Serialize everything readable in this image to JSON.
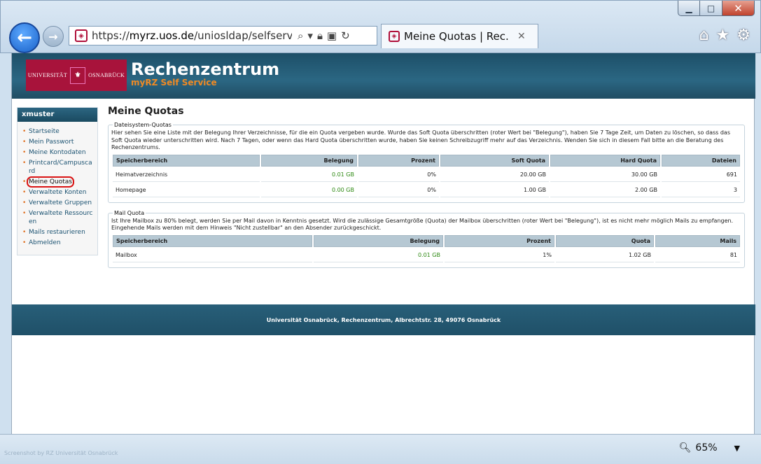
{
  "browser": {
    "url_prefix": "https://",
    "url_host": "myrz.uos.de",
    "url_path": "/uniosldap/selfservice/",
    "tab_title": "Meine Quotas | Rec...",
    "window_buttons": {
      "minimize": "▁",
      "maximize": "□",
      "close": "✕"
    },
    "zoom_level": "65%",
    "status_text": "Screenshot by RZ Universität Osnabrück"
  },
  "header": {
    "logo_left": "UNIVERSITÄT",
    "logo_right": "OSNABRÜCK",
    "title": "Rechenzentrum",
    "subtitle": "myRZ Self Service"
  },
  "sidebar": {
    "user": "xmuster",
    "items": [
      {
        "label": "Startseite"
      },
      {
        "label": "Mein Passwort"
      },
      {
        "label": "Meine Kontodaten"
      },
      {
        "label": "Printcard/Campuscard"
      },
      {
        "label": "Meine Quotas"
      },
      {
        "label": "Verwaltete Konten"
      },
      {
        "label": "Verwaltete Gruppen"
      },
      {
        "label": "Verwaltete Ressourcen"
      },
      {
        "label": "Mails restaurieren"
      },
      {
        "label": "Abmelden"
      }
    ]
  },
  "main": {
    "title": "Meine Quotas",
    "fs": {
      "legend": "Dateisystem-Quotas",
      "intro": "Hier sehen Sie eine Liste mit der Belegung Ihrer Verzeichnisse, für die ein Quota vergeben wurde. Wurde das Soft Quota überschritten (roter Wert bei \"Belegung\"), haben Sie 7 Tage Zeit, um Daten zu löschen, so dass das Soft Quota wieder unterschritten wird. Nach 7 Tagen, oder wenn das Hard Quota überschritten wurde, haben Sie keinen Schreibzugriff mehr auf das Verzeichnis. Wenden Sie sich in diesem Fall bitte an die Beratung des Rechenzentrums.",
      "headers": [
        "Speicherbereich",
        "Belegung",
        "Prozent",
        "Soft Quota",
        "Hard Quota",
        "Dateien"
      ],
      "rows": [
        [
          "Heimatverzeichnis",
          "0.01 GB",
          "0%",
          "20.00 GB",
          "30.00 GB",
          "691"
        ],
        [
          "Homepage",
          "0.00 GB",
          "0%",
          "1.00 GB",
          "2.00 GB",
          "3"
        ]
      ]
    },
    "mail": {
      "legend": "Mail Quota",
      "intro": "Ist Ihre Mailbox zu 80% belegt, werden Sie per Mail davon in Kenntnis gesetzt. Wird die zulässige Gesamtgröße (Quota) der Mailbox überschritten (roter Wert bei \"Belegung\"), ist es nicht mehr möglich Mails zu empfangen. Eingehende Mails werden mit dem Hinweis \"Nicht zustellbar\" an den Absender zurückgeschickt.",
      "headers": [
        "Speicherbereich",
        "Belegung",
        "Prozent",
        "Quota",
        "Mails"
      ],
      "rows": [
        [
          "Mailbox",
          "0.01 GB",
          "1%",
          "1.02 GB",
          "81"
        ]
      ]
    }
  },
  "footer": {
    "text": "Universität Osnabrück, Rechenzentrum, Albrechtstr. 28, 49076 Osnabrück"
  },
  "colors": {
    "header_bg": "#2b6783",
    "accent": "#f08a24",
    "brand": "#a8133b",
    "used_ok": "#2f8a14"
  }
}
